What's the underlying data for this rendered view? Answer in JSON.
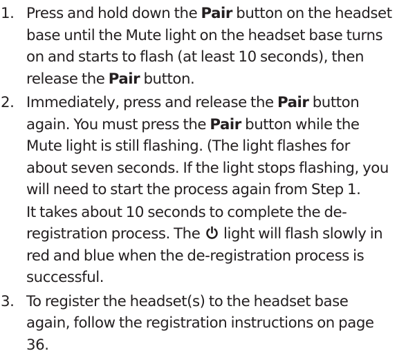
{
  "steps": [
    {
      "number": "1.",
      "paragraphs": [
        {
          "t1": "Press and hold down the ",
          "b1": "Pair",
          "t2": " button on the headset base until the Mute light on the headset base turns on and starts to flash (at least 10 seconds), then release the ",
          "b2": "Pair",
          "t3": " button."
        }
      ]
    },
    {
      "number": "2.",
      "paragraphs": [
        {
          "t1": "Immediately, press and release the ",
          "b1": "Pair",
          "t2": " button again. You must press the ",
          "b2": "Pair",
          "t3": " button while the Mute light is still flashing. (The light flashes for about seven seconds. If the light stops flashing, you will need to start the process again from Step 1."
        },
        {
          "t1": "It takes about 10 seconds to complete the de-registration process. The ",
          "icon": "power-icon",
          "t2": " light will flash slowly in red and blue when the de-registration process is successful."
        }
      ]
    },
    {
      "number": "3.",
      "paragraphs": [
        {
          "t1": "To register the headset(s) to the headset base again, follow the registration instructions on page 36."
        }
      ]
    }
  ]
}
